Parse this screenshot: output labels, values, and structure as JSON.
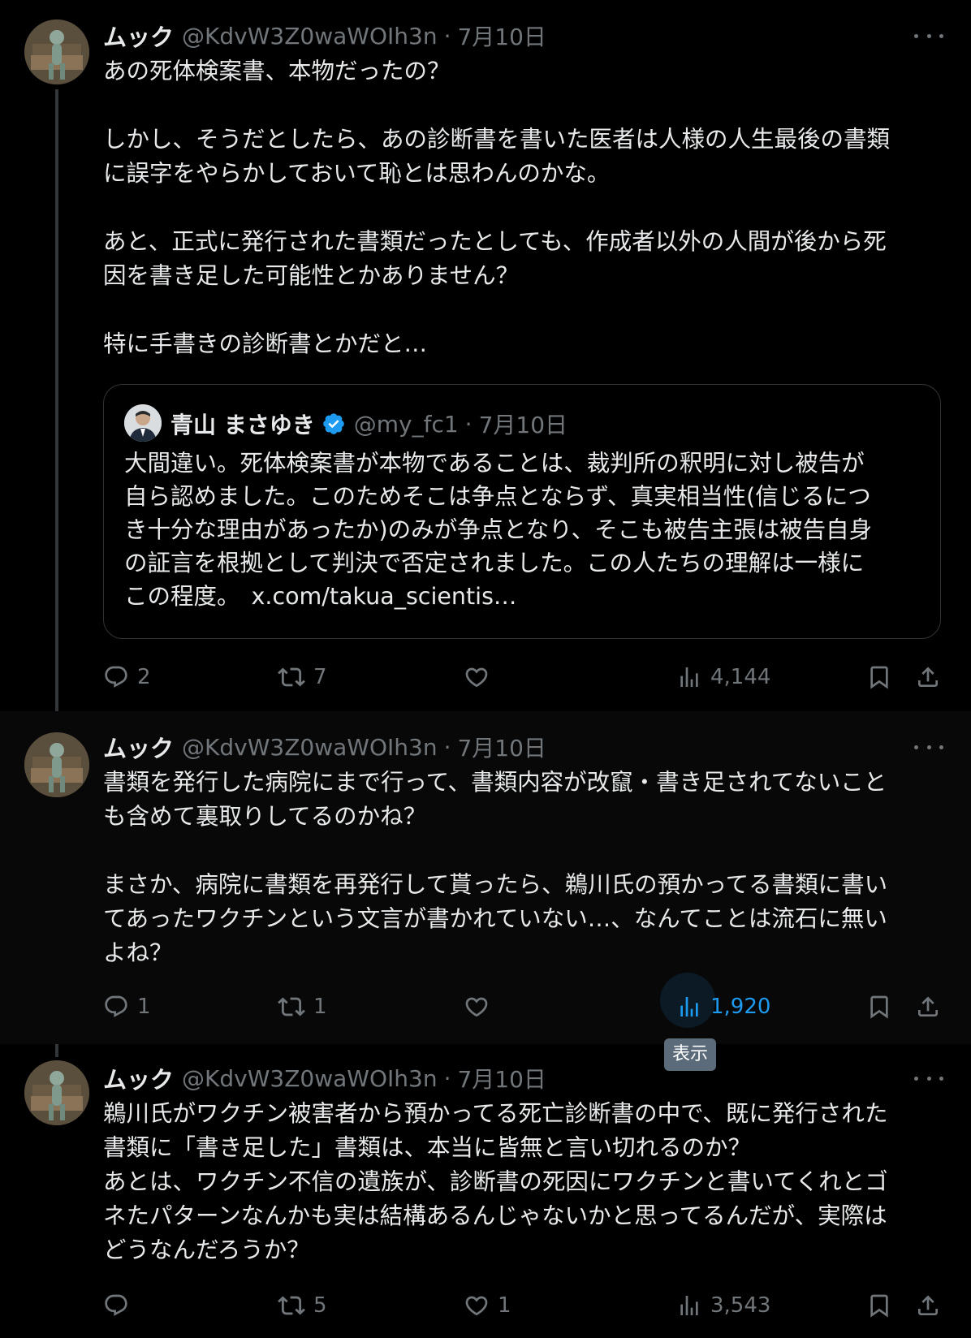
{
  "tweets": [
    {
      "name": "ムック",
      "handle": "@KdvW3Z0waWOIh3n",
      "separator": "·",
      "date": "7月10日",
      "lines": [
        "あの死体検案書、本物だったの？",
        "",
        "しかし、そうだとしたら、あの診断書を書いた医者は人様の人生最後の書類",
        "に誤字をやらかしておいて恥とは思わんのかな。",
        "",
        "あと、正式に発行された書類だったとしても、作成者以外の人間が後から死",
        "因を書き足した可能性とかありません？",
        "",
        "特に手書きの診断書とかだと…"
      ],
      "replies": "2",
      "retweets": "7",
      "likes": "",
      "views": "4,144"
    },
    {
      "name": "ムック",
      "handle": "@KdvW3Z0waWOIh3n",
      "separator": "·",
      "date": "7月10日",
      "lines": [
        "書類を発行した病院にまで行って、書類内容が改竄・書き足されてないこと",
        "も含めて裏取りしてるのかね？",
        "",
        "まさか、病院に書類を再発行して貰ったら、鵜川氏の預かってる書類に書い",
        "てあったワクチンという文言が書かれていない…、なんてことは流石に無い",
        "よね？"
      ],
      "replies": "1",
      "retweets": "1",
      "likes": "",
      "views": "1,920",
      "views_tooltip": "表示"
    },
    {
      "name": "ムック",
      "handle": "@KdvW3Z0waWOIh3n",
      "separator": "·",
      "date": "7月10日",
      "lines": [
        "鵜川氏がワクチン被害者から預かってる死亡診断書の中で、既に発行された",
        "書類に「書き足した」書類は、本当に皆無と言い切れるのか？",
        "あとは、ワクチン不信の遺族が、診断書の死因にワクチンと書いてくれとゴ",
        "ネたパターンなんかも実は結構あるんじゃないかと思ってるんだが、実際は",
        "どうなんだろうか？"
      ],
      "replies": "",
      "retweets": "5",
      "likes": "1",
      "views": "3,543"
    }
  ],
  "quote": {
    "name": "青山 まさゆき",
    "handle": "@my_fc1",
    "separator": "·",
    "date": "7月10日",
    "lines": [
      "大間違い。死体検案書が本物であることは、裁判所の釈明に対し被告が",
      "自ら認めました。このためそこは争点とならず、真実相当性(信じるにつ",
      "き十分な理由があったか)のみが争点となり、そこも被告主張は被告自身",
      "の証言を根拠として判決で否定されました。この人たちの理解は一様に",
      "この程度。"
    ],
    "link": "x.com/takua_scientis…"
  },
  "colors": {
    "background": "#000000",
    "text": "#e7e9ea",
    "secondary": "#71767b",
    "accent": "#1d9bf0",
    "border": "#2f3336"
  }
}
